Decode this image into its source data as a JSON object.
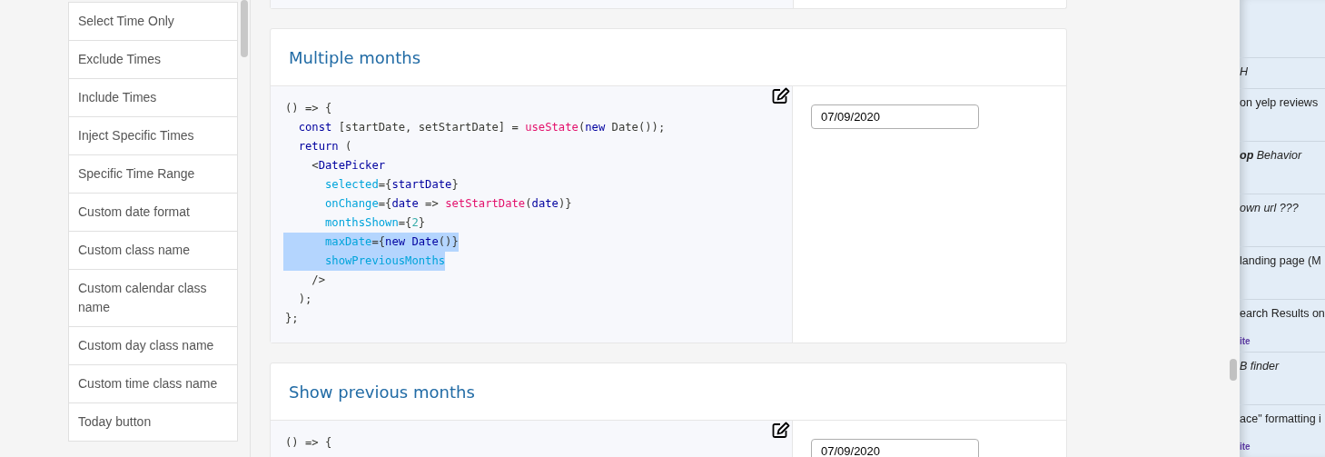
{
  "nav": {
    "items": [
      {
        "label": "Select Time Only",
        "selected": false
      },
      {
        "label": "Exclude Times",
        "selected": false
      },
      {
        "label": "Include Times",
        "selected": false
      },
      {
        "label": "Inject Specific Times",
        "selected": false
      },
      {
        "label": "Specific Time Range",
        "selected": false
      },
      {
        "label": "Custom date format",
        "selected": false
      },
      {
        "label": "Custom class name",
        "selected": false
      },
      {
        "label": "Custom calendar class name",
        "selected": false
      },
      {
        "label": "Custom day class name",
        "selected": false
      },
      {
        "label": "Custom time class name",
        "selected": false
      },
      {
        "label": "Today button",
        "selected": false
      }
    ]
  },
  "examples": [
    {
      "title": "Multiple months",
      "date_value": "07/09/2020",
      "code": [
        {
          "selected": false,
          "tokens": [
            {
              "t": "() => {"
            }
          ]
        },
        {
          "selected": false,
          "tokens": [
            {
              "color": "#00009f",
              "t": "  const"
            },
            {
              "t": " [startDate, setStartDate] = "
            },
            {
              "color": "#e3116c",
              "t": "useState"
            },
            {
              "t": "("
            },
            {
              "color": "#00009f",
              "t": "new"
            },
            {
              "t": " Date());"
            }
          ]
        },
        {
          "selected": false,
          "tokens": [
            {
              "color": "#00009f",
              "t": "  return"
            },
            {
              "t": " ("
            }
          ]
        },
        {
          "selected": false,
          "tokens": [
            {
              "t": "    <"
            },
            {
              "color": "#00009f",
              "t": "DatePicker"
            }
          ]
        },
        {
          "selected": false,
          "tokens": [
            {
              "color": "#00a4db",
              "t": "      selected"
            },
            {
              "t": "={"
            },
            {
              "color": "#00009f",
              "t": "startDate"
            },
            {
              "t": "}"
            }
          ]
        },
        {
          "selected": false,
          "tokens": [
            {
              "color": "#00a4db",
              "t": "      onChange"
            },
            {
              "t": "={"
            },
            {
              "color": "#00009f",
              "t": "date"
            },
            {
              "t": " => "
            },
            {
              "color": "#e3116c",
              "t": "setStartDate"
            },
            {
              "t": "("
            },
            {
              "color": "#00009f",
              "t": "date"
            },
            {
              "t": ")}"
            }
          ]
        },
        {
          "selected": false,
          "tokens": [
            {
              "color": "#00a4db",
              "t": "      monthsShown"
            },
            {
              "t": "={"
            },
            {
              "color": "#36acaa",
              "t": "2"
            },
            {
              "t": "}"
            }
          ]
        },
        {
          "selected": true,
          "tokens": [
            {
              "color": "#00a4db",
              "t": "      maxDate"
            },
            {
              "t": "={"
            },
            {
              "color": "#00009f",
              "t": "new Date"
            },
            {
              "t": "()}"
            }
          ]
        },
        {
          "selected": true,
          "tokens": [
            {
              "color": "#00a4db",
              "t": "      showPreviousMonths"
            }
          ]
        },
        {
          "selected": false,
          "tokens": [
            {
              "t": "    />"
            }
          ]
        },
        {
          "selected": false,
          "tokens": [
            {
              "t": "  );"
            }
          ]
        },
        {
          "selected": false,
          "tokens": [
            {
              "t": "};"
            }
          ]
        }
      ]
    },
    {
      "title": "Show previous months",
      "date_value": "07/09/2020",
      "code": [
        {
          "selected": false,
          "tokens": [
            {
              "t": "() => {"
            }
          ]
        }
      ]
    }
  ],
  "side_panel": {
    "rows": [
      {
        "text": "H",
        "italic": true
      },
      {
        "text": "on yelp reviews",
        "italic": false
      },
      {
        "text": "**op** Behavior",
        "italic": true
      },
      {
        "text": "own url ???",
        "italic": true
      },
      {
        "text": "landing page (M",
        "italic": false
      },
      {
        "text": "earch Results on",
        "italic": false,
        "tag": "ite"
      },
      {
        "text": "B finder",
        "italic": true
      },
      {
        "text": "ace\" formatting i",
        "italic": false,
        "tag": "ite"
      }
    ]
  }
}
